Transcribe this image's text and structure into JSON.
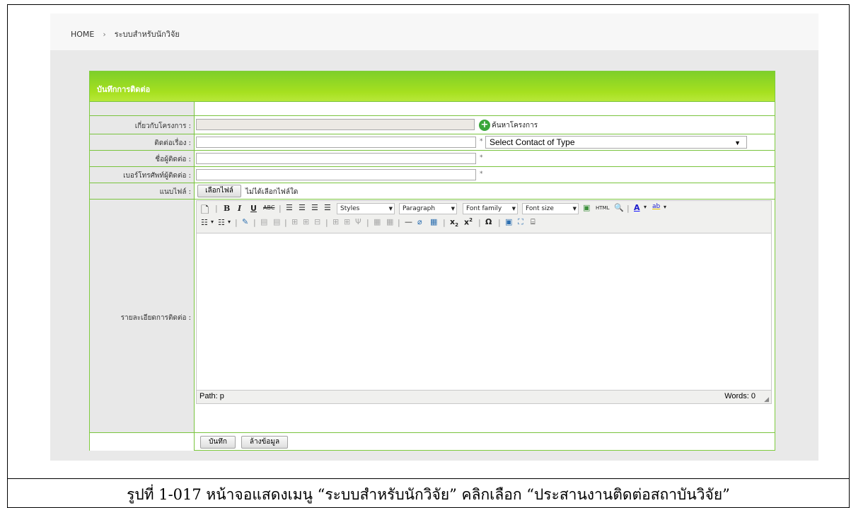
{
  "breadcrumb": {
    "home": "HOME",
    "separator": "›",
    "current": "ระบบสำหรับนักวิจัย"
  },
  "panel": {
    "title": "บันทึกการติดต่อ"
  },
  "form": {
    "project_label": "เกี่ยวกับโครงการ :",
    "search_project_link": "ค้นหาโครงการ",
    "subject_label": "ติดต่อเรื่อง :",
    "contact_type_select": "Select Contact of Type",
    "contact_name_label": "ชื่อผู้ติดต่อ :",
    "phone_label": "เบอร์โทรศัพท์ผู้ติดต่อ :",
    "attach_label": "แนบไฟล์ :",
    "choose_file_button": "เลือกไฟล์",
    "no_file_text": "ไม่ได้เลือกไฟล์ใด",
    "details_label": "รายละเอียดการติดต่อ :",
    "required_mark": "*"
  },
  "editor": {
    "styles": "Styles",
    "paragraph": "Paragraph",
    "font_family": "Font family",
    "font_size": "Font size",
    "html_btn": "HTML",
    "path": "Path: p",
    "words": "Words: 0"
  },
  "actions": {
    "save": "บันทึก",
    "clear": "ล้างข้อมูล"
  },
  "caption": "รูปที่ 1-017 หน้าจอแสดงเมนู “ระบบสำหรับนักวิจัย” คลิกเลือก “ประสานงานติดต่อสถาบันวิจัย”",
  "colors": {
    "accent_green": "#8fd41f",
    "border_green": "#79c43d"
  }
}
